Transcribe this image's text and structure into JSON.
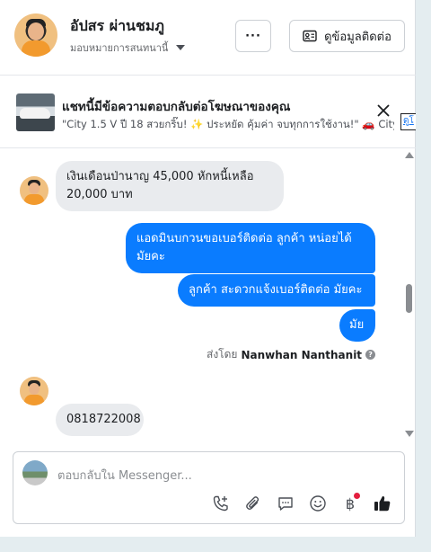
{
  "header": {
    "name": "อัปสร ผ่านชมภู",
    "assignment_label": "มอบหมายการสนทนานี้",
    "more_label": "···",
    "contact_label": "ดูข้อมูลติดต่อ"
  },
  "ad_banner": {
    "title": "แชทนี้มีข้อความตอบกลับต่อโฆษณาของคุณ",
    "subtitle": "\"City 1.5 V ปี 18 สวยกริ๊บ! ✨ ประหยัด คุ้มค่า จบทุกการใช้งาน!\" 🚗 City ...",
    "edge_link": "ดูโ"
  },
  "messages": [
    {
      "direction": "in",
      "text": "เงินเดือนป่านาญ 45,000 หักหนี้เหลือ 20,000 บาท"
    },
    {
      "direction": "out",
      "text": "แอดมินบกวนขอเบอร์ติดต่อ ลูกค้า   หน่อยได้มัยคะ"
    },
    {
      "direction": "out",
      "text": "ลูกค้า สะดวกแจ้งเบอร์ติดต่อ มัยคะ"
    },
    {
      "direction": "out",
      "text": "มัย"
    },
    {
      "direction": "in",
      "text": "0818722008"
    }
  ],
  "sent_by": {
    "prefix": "ส่งโดย",
    "agent": "Nanwhan Nanthanit"
  },
  "composer": {
    "placeholder": "ตอบกลับใน Messenger..."
  },
  "colors": {
    "outgoing_bubble": "#0a7cff",
    "incoming_bubble": "#e9ebee",
    "like_icon": "#1c1e21"
  }
}
